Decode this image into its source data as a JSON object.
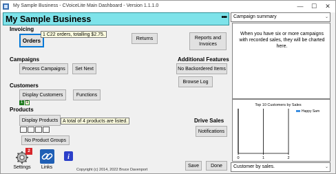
{
  "window": {
    "title": "My Sample Business - CVoiceLite Main Dashboard - Version 1.1.1.0",
    "minimize_glyph": "—",
    "maximize_glyph": "☐",
    "close_glyph": "✕"
  },
  "banner": {
    "business_name": "My Sample Business",
    "menu_glyph": "•••"
  },
  "invoicing": {
    "heading": "Invoicing",
    "orders_label": "Orders",
    "orders_tip": "1 C22 orders, totalling $2.75.",
    "returns_label": "Returns",
    "reports_label": "Reports and Invoices"
  },
  "campaigns": {
    "heading": "Campaigns",
    "process_label": "Process Campaigns",
    "setnext_label": "Set Next"
  },
  "additional": {
    "heading": "Additional Features",
    "no_backordered_label": "No Backordered Items",
    "browse_log_label": "Browse Log"
  },
  "customers": {
    "heading": "Customers",
    "display_label": "Display Customers",
    "functions_label": "Functions",
    "indicators": [
      "1",
      "1"
    ]
  },
  "products": {
    "heading": "Products",
    "display_label": "Display Products",
    "tip": "A total of 4 products are listed.",
    "no_groups_label": "No Product Groups"
  },
  "drive_sales": {
    "heading": "Drive Sales",
    "notifications_label": "Notifications"
  },
  "bottom": {
    "settings_label": "Settings",
    "settings_badge": "2",
    "links_label": "Links",
    "copyright": "Copyright (c) 2014, 2022 Bruce Davenport",
    "save_label": "Save",
    "done_label": "Done"
  },
  "right_panel": {
    "summary_select": "Campaign summary",
    "summary_text": "When you have six or more campaigns with recorded sales, they will be charted here.",
    "chart_select": "Customer by sales."
  },
  "colors": {
    "banner": "#7ee3ea",
    "badge": "#d7262b",
    "series": "#3c8ee0",
    "indicator": "#1e7a1e"
  },
  "chart_data": {
    "type": "bar",
    "title": "Top 10 Customers by Sales",
    "series": [
      {
        "name": "Happy Sam",
        "values": [
          0
        ]
      }
    ],
    "xlim": [
      0,
      2
    ],
    "x_ticks": [
      "0",
      "1",
      "2"
    ]
  }
}
